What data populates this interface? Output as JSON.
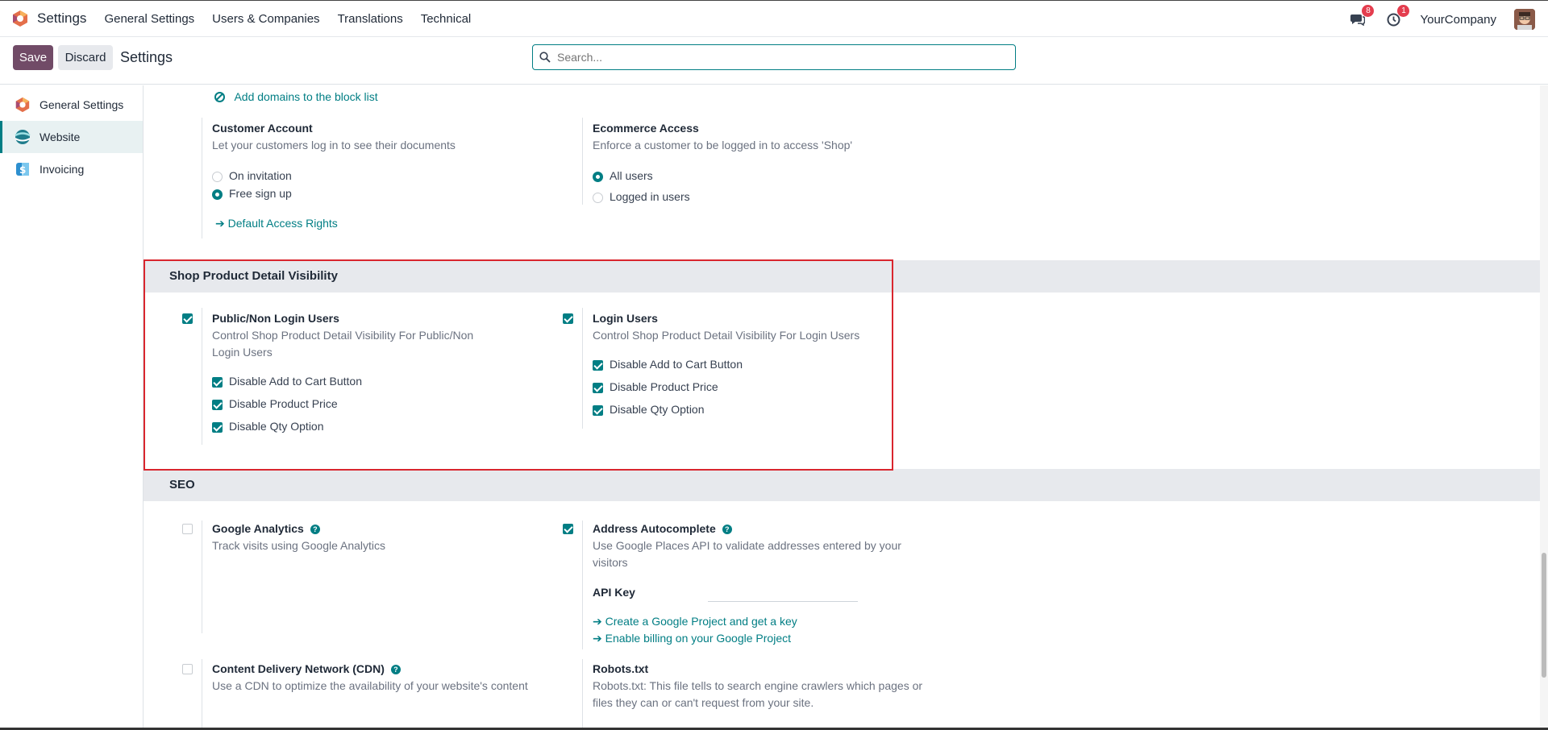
{
  "navbar": {
    "app_name": "Settings",
    "menu": [
      "General Settings",
      "Users & Companies",
      "Translations",
      "Technical"
    ],
    "messages_badge": "8",
    "activity_badge": "1",
    "company": "YourCompany"
  },
  "control": {
    "save_label": "Save",
    "discard_label": "Discard",
    "breadcrumb": "Settings",
    "search_placeholder": "Search..."
  },
  "sidebar": {
    "items": [
      {
        "label": "General Settings"
      },
      {
        "label": "Website"
      },
      {
        "label": "Invoicing"
      }
    ]
  },
  "top_block": {
    "block_list_link": "Add domains to the block list",
    "customer_account": {
      "title": "Customer Account",
      "desc": "Let your customers log in to see their documents",
      "options": [
        "On invitation",
        "Free sign up"
      ],
      "selected": "Free sign up",
      "link": "Default Access Rights"
    },
    "ecommerce_access": {
      "title": "Ecommerce Access",
      "desc": "Enforce a customer to be logged in to access 'Shop'",
      "options": [
        "All users",
        "Logged in users"
      ],
      "selected": "All users"
    }
  },
  "visibility": {
    "section_title": "Shop Product Detail Visibility",
    "public": {
      "title": "Public/Non Login Users",
      "desc": "Control Shop Product Detail Visibility For Public/Non Login Users",
      "checked": true,
      "options": [
        "Disable Add to Cart Button",
        "Disable Product Price",
        "Disable Qty Option"
      ]
    },
    "login": {
      "title": "Login Users",
      "desc": "Control Shop Product Detail Visibility For Login Users",
      "checked": true,
      "options": [
        "Disable Add to Cart Button",
        "Disable Product Price",
        "Disable Qty Option"
      ]
    }
  },
  "seo": {
    "section_title": "SEO",
    "google_analytics": {
      "title": "Google Analytics",
      "desc": "Track visits using Google Analytics",
      "checked": false
    },
    "address_autocomplete": {
      "title": "Address Autocomplete",
      "desc": "Use Google Places API to validate addresses entered by your visitors",
      "checked": true,
      "api_key_label": "API Key",
      "api_key_value": "",
      "link1": "Create a Google Project and get a key",
      "link2": "Enable billing on your Google Project"
    },
    "cdn": {
      "title": "Content Delivery Network (CDN)",
      "desc": "Use a CDN to optimize the availability of your website's content",
      "checked": false
    },
    "robots": {
      "title": "Robots.txt",
      "desc": "Robots.txt: This file tells to search engine crawlers which pages or files they can or can't request from your site."
    }
  },
  "colors": {
    "primary": "#714b67",
    "accent": "#017e84",
    "highlight_border": "#d9262e",
    "badge": "#e43d4e"
  }
}
